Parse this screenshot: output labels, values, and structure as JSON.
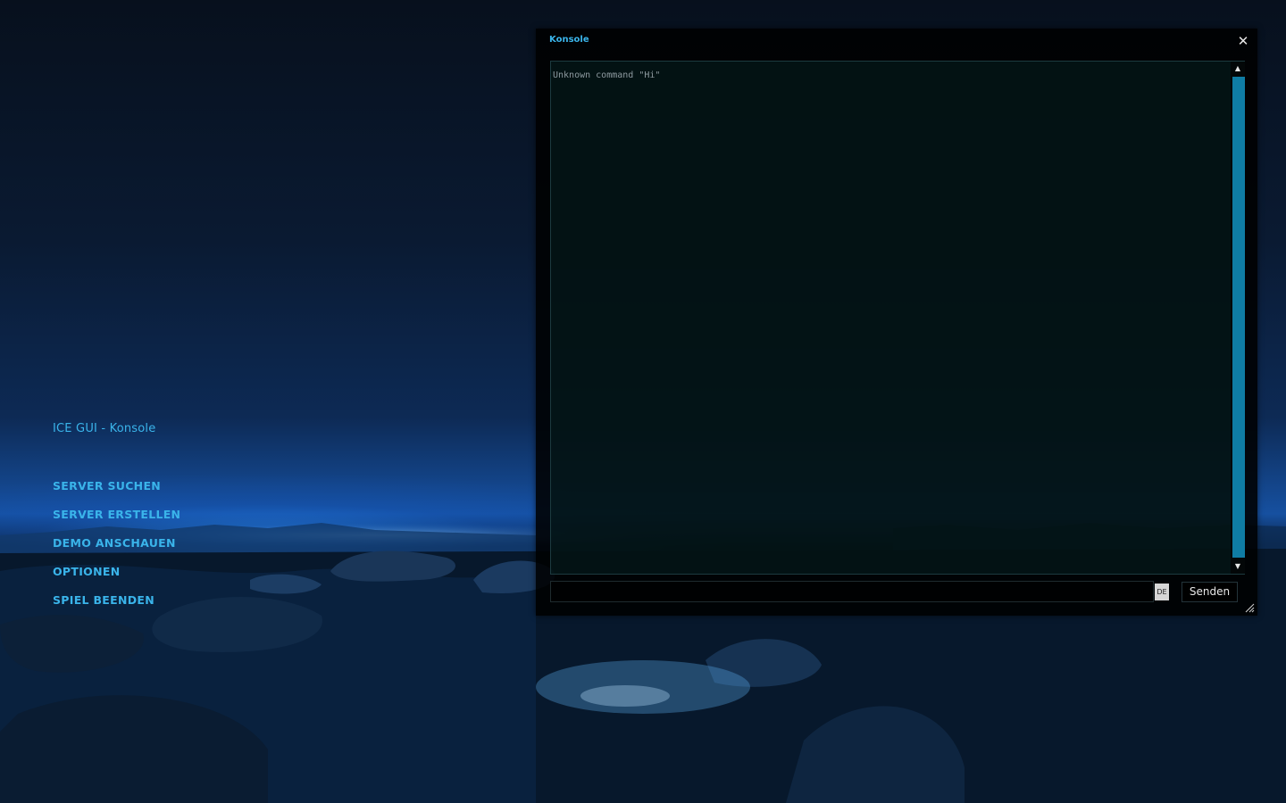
{
  "menu": {
    "title": "ICE GUI - Konsole",
    "items": [
      {
        "label": "SERVER SUCHEN"
      },
      {
        "label": "SERVER ERSTELLEN"
      },
      {
        "label": "DEMO ANSCHAUEN"
      },
      {
        "label": "OPTIONEN"
      },
      {
        "label": "SPIEL BEENDEN"
      }
    ]
  },
  "console": {
    "title": "Konsole",
    "close_icon": "✕",
    "output_lines": [
      "Unknown command \"Hi\""
    ],
    "input_value": "",
    "language_badge": "DE",
    "send_label": "Senden",
    "scroll_up_icon": "▲",
    "scroll_down_icon": "▼"
  },
  "colors": {
    "accent": "#3ab4ea",
    "scrollbar_thumb": "#0f7ca4",
    "window_bg": "#000000"
  }
}
